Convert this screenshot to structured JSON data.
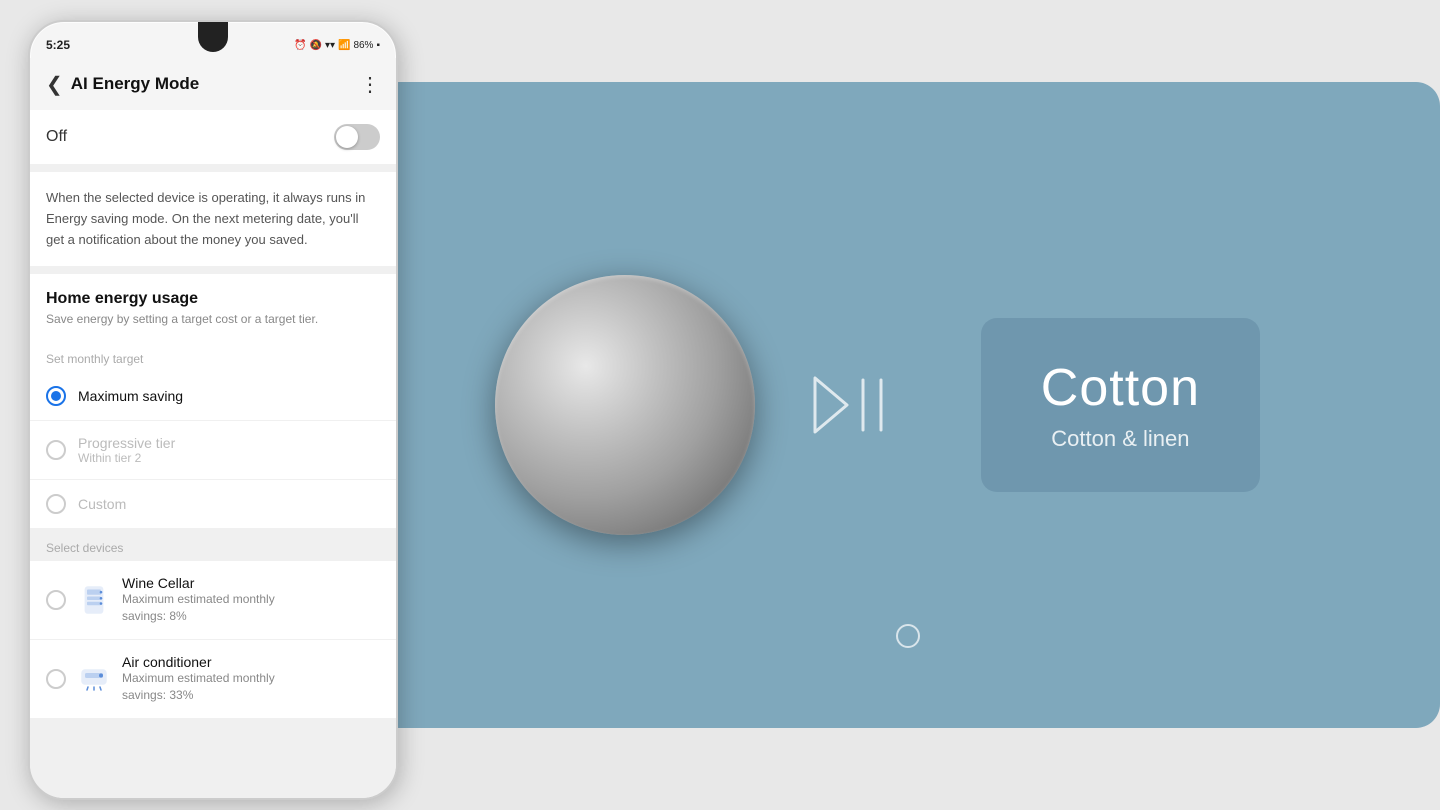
{
  "phone": {
    "status_bar": {
      "time": "5:25",
      "icons_text": "⏰ 🔕 📶 📶 86%"
    },
    "nav": {
      "back_icon": "‹",
      "title": "AI Energy Mode",
      "more_icon": "⋮"
    },
    "toggle": {
      "label": "Off",
      "state": "off"
    },
    "description": "When the selected device is operating, it always runs in Energy saving mode. On the next metering date, you'll get a notification about the money you saved.",
    "home_energy": {
      "title": "Home energy usage",
      "subtitle": "Save energy by setting a target cost or a target tier.",
      "set_target_label": "Set monthly target"
    },
    "radio_options": [
      {
        "id": "maximum-saving",
        "label": "Maximum saving",
        "sub_label": "",
        "selected": true,
        "dimmed": false
      },
      {
        "id": "progressive-tier",
        "label": "Progressive tier",
        "sub_label": "Within tier 2",
        "selected": false,
        "dimmed": true
      },
      {
        "id": "custom",
        "label": "Custom",
        "sub_label": "",
        "selected": false,
        "dimmed": true
      }
    ],
    "devices_section": {
      "label": "Select devices"
    },
    "devices": [
      {
        "id": "wine-cellar",
        "name": "Wine Cellar",
        "savings": "Maximum estimated monthly savings: 8%",
        "icon_type": "wine-cellar"
      },
      {
        "id": "air-conditioner",
        "name": "Air conditioner",
        "savings": "Maximum estimated monthly savings: 33%",
        "icon_type": "air-conditioner"
      }
    ]
  },
  "washer_panel": {
    "cycle_name": "Cotton",
    "cycle_subtitle": "Cotton & linen",
    "play_pause_label": "▷❙❙",
    "background_color": "#7fa8bc"
  }
}
